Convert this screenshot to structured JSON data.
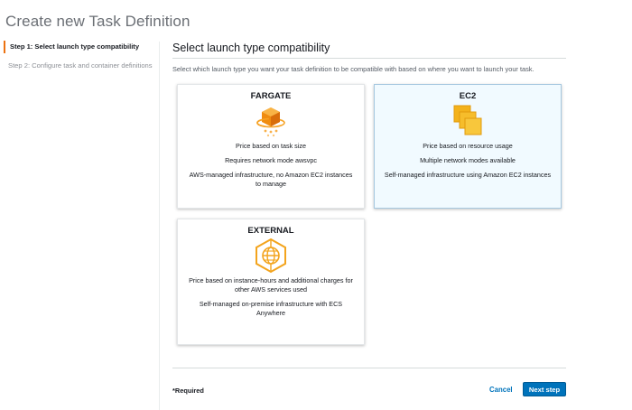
{
  "header": {
    "title": "Create new Task Definition"
  },
  "steps": [
    {
      "label": "Step 1: Select launch type compatibility",
      "active": true
    },
    {
      "label": "Step 2: Configure task and container definitions",
      "active": false
    }
  ],
  "section": {
    "title": "Select launch type compatibility",
    "description": "Select which launch type you want your task definition to be compatible with based on where you want to launch your task."
  },
  "cards": {
    "fargate": {
      "title": "FARGATE",
      "icon": "fargate-icon",
      "lines": [
        "Price based on task size",
        "Requires network mode awsvpc",
        "AWS-managed infrastructure, no Amazon EC2 instances to manage"
      ]
    },
    "ec2": {
      "title": "EC2",
      "icon": "ec2-instances-icon",
      "selected": true,
      "lines": [
        "Price based on resource usage",
        "Multiple network modes available",
        "Self-managed infrastructure using Amazon EC2 instances"
      ]
    },
    "external": {
      "title": "EXTERNAL",
      "icon": "external-globe-icon",
      "lines": [
        "Price based on instance-hours and additional charges for other AWS services used",
        "Self-managed on-premise infrastructure with ECS Anywhere"
      ]
    }
  },
  "footer": {
    "required_label": "*Required",
    "cancel_label": "Cancel",
    "next_label": "Next step"
  },
  "colors": {
    "accent": "#ec7211",
    "primary": "#0073bb",
    "selected_bg": "#f1faff"
  }
}
